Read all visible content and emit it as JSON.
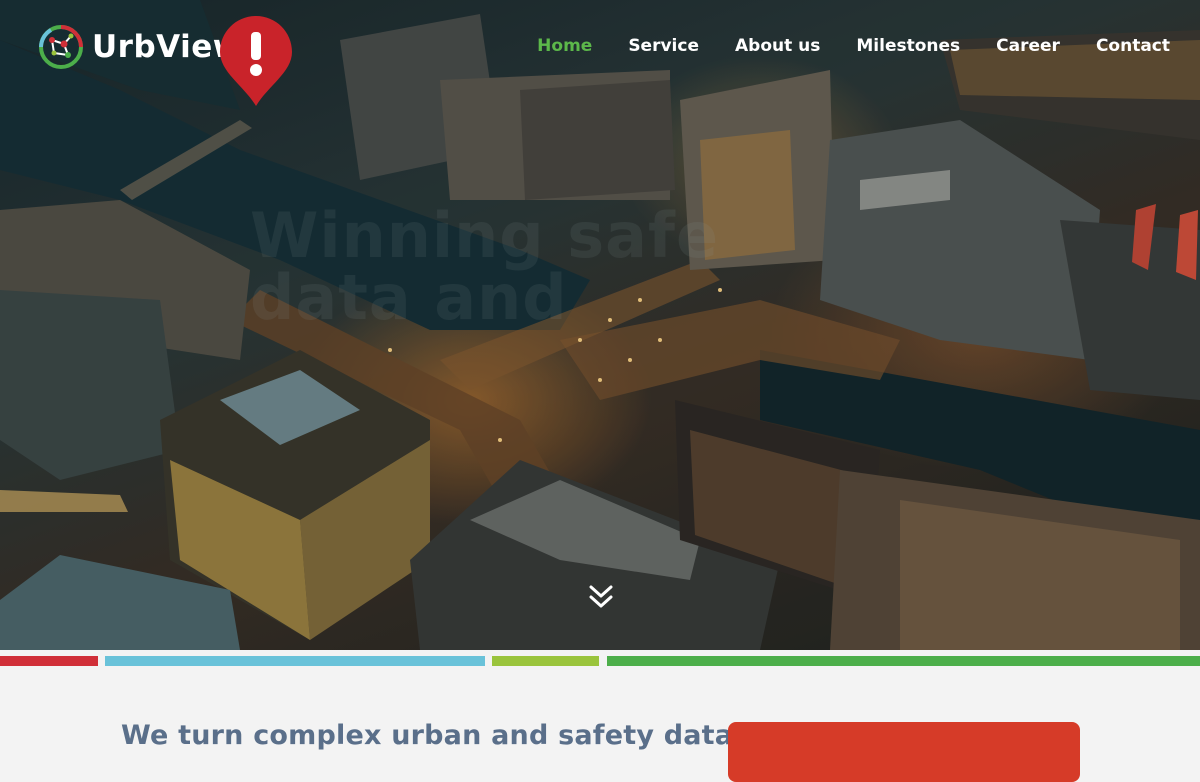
{
  "brand": {
    "name": "UrbView"
  },
  "nav": {
    "items": [
      {
        "label": "Home",
        "active": true
      },
      {
        "label": "Service",
        "active": false
      },
      {
        "label": "About us",
        "active": false
      },
      {
        "label": "Milestones",
        "active": false
      },
      {
        "label": "Career",
        "active": false
      },
      {
        "label": "Contact",
        "active": false
      }
    ]
  },
  "hero": {
    "overlay_text": "Winning safe data and"
  },
  "content": {
    "headline": "We turn complex urban and safety data"
  },
  "colors": {
    "nav_active": "#5cb84a",
    "stripe_red": "#d02f38",
    "stripe_blue": "#69c2d9",
    "stripe_lime": "#9ac43c",
    "stripe_green": "#4cae4a",
    "headline": "#5a6f8a",
    "card_red": "#d63b28"
  },
  "icons": {
    "logo": "urbview-network-logo",
    "alert": "map-pin-alert-icon",
    "scroll": "double-chevron-down-icon"
  }
}
